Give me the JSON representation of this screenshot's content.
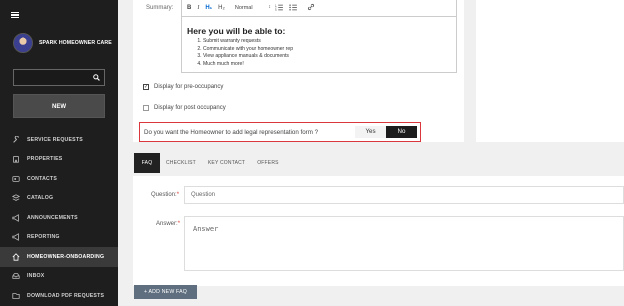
{
  "sidebar": {
    "brand": "SPARK HOMEOWNER CARE",
    "search_placeholder": "",
    "new_label": "NEW",
    "items": [
      {
        "label": "SERVICE REQUESTS",
        "icon": "wrench-icon"
      },
      {
        "label": "PROPERTIES",
        "icon": "building-icon"
      },
      {
        "label": "CONTACTS",
        "icon": "contacts-icon"
      },
      {
        "label": "CATALOG",
        "icon": "catalog-icon"
      },
      {
        "label": "ANNOUNCEMENTS",
        "icon": "megaphone-icon"
      },
      {
        "label": "REPORTING",
        "icon": "megaphone-icon"
      },
      {
        "label": "HOMEOWNER-ONBOARDING",
        "icon": "home-icon",
        "active": true
      },
      {
        "label": "INBOX",
        "icon": "inbox-icon"
      },
      {
        "label": "DOWNLOAD PDF REQUESTS",
        "icon": "download-icon"
      }
    ]
  },
  "summary": {
    "label": "Summary:",
    "toolbar": {
      "bold": "B",
      "italic": "I",
      "h1": "H₁",
      "h2": "H₂",
      "format": "Normal"
    },
    "heading": "Here you will be able to:",
    "list": [
      "Submit warranty requests",
      "Communicate with your homeowner rep",
      "View appliance manuals & documents",
      "Much much more!"
    ]
  },
  "options": {
    "pre_occupancy": {
      "label": "Display for pre-occupancy",
      "checked": true
    },
    "post_occupancy": {
      "label": "Display for post occupancy",
      "checked": false
    },
    "legal_question": "Do you want the Homeowner to add legal representation form ?",
    "yes_label": "Yes",
    "no_label": "No",
    "selected": "No"
  },
  "tabs": [
    "FAQ",
    "CHECKLIST",
    "KEY CONTACT",
    "OFFERS"
  ],
  "faq_form": {
    "question_label": "Question:",
    "question_placeholder": "Question",
    "answer_label": "Answer:",
    "answer_placeholder": "Answer",
    "add_button": "+ ADD NEW FAQ"
  },
  "colors": {
    "sidebar_bg": "#1e1e1e",
    "highlight_border": "#d9363e",
    "no_active": "#1c1c1c",
    "add_button": "#5f6f7f"
  }
}
